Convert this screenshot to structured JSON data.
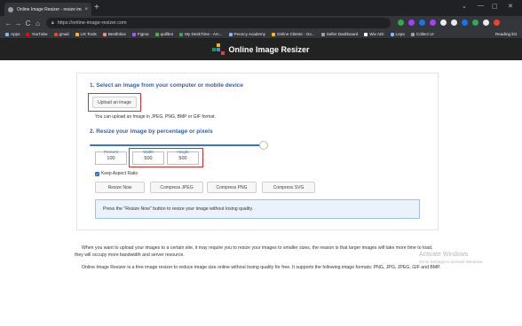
{
  "browser": {
    "tab_title": "Online Image Resizer - resize ima",
    "tab_close": "×",
    "new_tab": "+",
    "window_controls": [
      "⌄",
      "—",
      "▢",
      "✕"
    ],
    "nav": {
      "back": "←",
      "forward": "→",
      "reload": "C",
      "home": "⌂"
    },
    "url": "https://online-image-resizer.com",
    "bookmarks": [
      {
        "label": "Apps",
        "color": "#8ab4f8"
      },
      {
        "label": "YouTube",
        "color": "#ff0000"
      },
      {
        "label": "gmail",
        "color": "#ea4335"
      },
      {
        "label": "UX Tools",
        "color": "#fbbc04"
      },
      {
        "label": "Bestfolios",
        "color": "#f28b82"
      },
      {
        "label": "Figma",
        "color": "#a259ff"
      },
      {
        "label": "quillbot",
        "color": "#4caf50"
      },
      {
        "label": "My DeskTime - Am...",
        "color": "#34a853"
      },
      {
        "label": "Peoncy Academy",
        "color": "#8ab4f8"
      },
      {
        "label": "Online Clients - Go...",
        "color": "#fbbc04"
      },
      {
        "label": "Seller Dashboard",
        "color": "#9aa0a6"
      },
      {
        "label": "Wix ADI",
        "color": "#ffffff"
      },
      {
        "label": "Lepa",
        "color": "#8ab4f8"
      },
      {
        "label": "Collect UI",
        "color": "#9aa0a6"
      }
    ],
    "reading_list": "Reading list",
    "extension_colors": [
      "#34a853",
      "#a142f4",
      "#1a73e8",
      "#a142f4",
      "#e8eaed",
      "#e8eaed",
      "#1a73e8",
      "#34a853",
      "#e8eaed",
      "#ea4335"
    ]
  },
  "site": {
    "title": "Online Image Resizer",
    "logo_colors": [
      "#f4b400",
      "#0f9d58",
      "#4285f4",
      "#db4437"
    ]
  },
  "tool": {
    "step1_heading": "1. Select an image from your computer or mobile device",
    "upload_button": "Upload an image",
    "upload_note": "You can upload an Image in JPEG, PNG, BMP or GIF format.",
    "step2_heading": "2. Resize your image by percentage or pixels",
    "slider_value_fraction": 1.0,
    "percent": {
      "label": "Percent",
      "value": "100"
    },
    "width": {
      "label": "Width",
      "value": "500"
    },
    "height": {
      "label": "Height",
      "value": "500"
    },
    "keep_aspect_label": "Keep Aspect Ratio",
    "keep_aspect_checked": true,
    "checkmark": "✓",
    "buttons": {
      "resize": "Resize Now",
      "compress_jpeg": "Compress JPEG",
      "compress_png": "Compress PNG",
      "compress_svg": "Compress SVG"
    },
    "info_text": "Press the \"Resize Now\" button to resize your image without losing quality.",
    "highlight_color": "#e02b2b",
    "accent_color": "#3b6fd8"
  },
  "content": {
    "paragraph1": "When you want to upload your images to a certain site, it may require you to resize your images to smaller sizes, the reason is that larger images will take more time to load, they will occupy more bandwidth and server resource.",
    "paragraph2": "Online Image Resizer is a free image resizer to reduce image size online without losing quality for free. It supports the following image formats: PNG, JPG, JPEG, GIF and BMP."
  },
  "watermark": {
    "title": "Activate Windows",
    "subtitle": "Go to Settings to activate Windows."
  }
}
